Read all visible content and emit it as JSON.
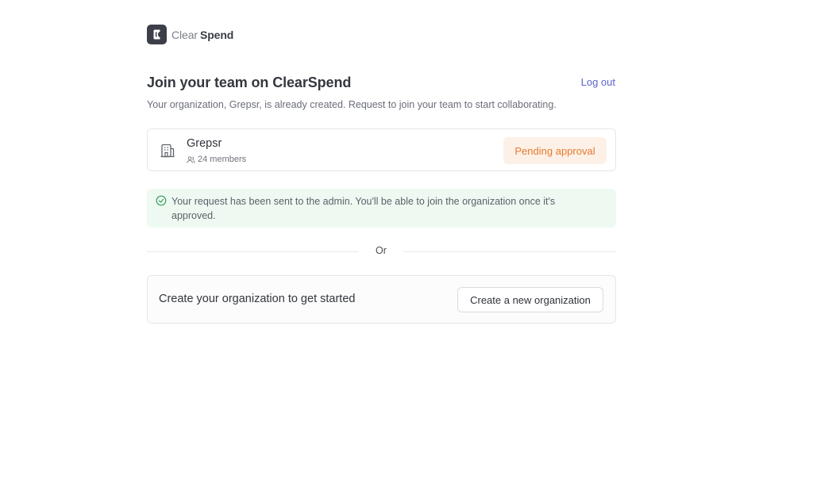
{
  "brand": {
    "name_light": "Clear",
    "name_bold": "Spend",
    "logo_icon": "clearspend-logo-icon"
  },
  "header": {
    "title": "Join your team on ClearSpend",
    "logout_label": "Log out",
    "subtitle": "Your organization, Grepsr, is already created. Request to join your team to start collaborating."
  },
  "organization": {
    "icon": "building-icon",
    "name": "Grepsr",
    "members_icon": "users-icon",
    "members_label": "24 members",
    "status_badge": "Pending approval"
  },
  "notice": {
    "icon": "check-circle-icon",
    "text": "Your request has been sent to the admin. You'll be able to join the organization once it's approved."
  },
  "divider": {
    "label": "Or"
  },
  "create": {
    "prompt": "Create your organization to get started",
    "button_label": "Create a new organization"
  },
  "colors": {
    "accent_link": "#5b64c9",
    "pending_bg": "#fdf1e7",
    "pending_text": "#e57a2f",
    "success_bg": "#eefaf1",
    "success_icon": "#2f9e5b"
  }
}
